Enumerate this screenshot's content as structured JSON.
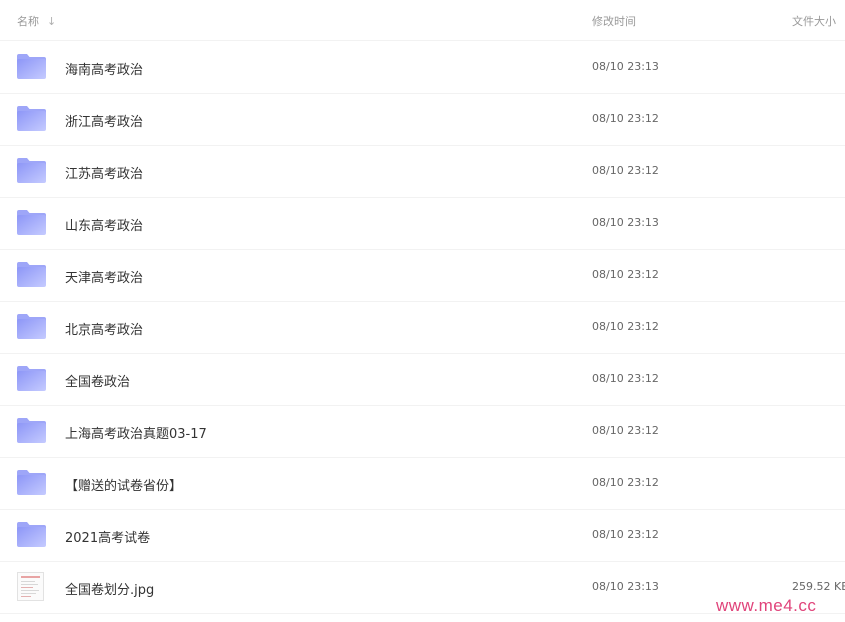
{
  "header": {
    "name_label": "名称",
    "sort_icon": "↓",
    "time_label": "修改时间",
    "size_label": "文件大小"
  },
  "colors": {
    "folder_light": "#c5cbff",
    "folder_dark": "#8d96f7",
    "watermark": "#e0437a"
  },
  "rows": [
    {
      "type": "folder",
      "name": "海南高考政治",
      "time": "08/10 23:13",
      "size": ""
    },
    {
      "type": "folder",
      "name": "浙江高考政治",
      "time": "08/10 23:12",
      "size": ""
    },
    {
      "type": "folder",
      "name": "江苏高考政治",
      "time": "08/10 23:12",
      "size": ""
    },
    {
      "type": "folder",
      "name": "山东高考政治",
      "time": "08/10 23:13",
      "size": ""
    },
    {
      "type": "folder",
      "name": "天津高考政治",
      "time": "08/10 23:12",
      "size": ""
    },
    {
      "type": "folder",
      "name": "北京高考政治",
      "time": "08/10 23:12",
      "size": ""
    },
    {
      "type": "folder",
      "name": "全国卷政治",
      "time": "08/10 23:12",
      "size": ""
    },
    {
      "type": "folder",
      "name": "上海高考政治真题03-17",
      "time": "08/10 23:12",
      "size": ""
    },
    {
      "type": "folder",
      "name": "【赠送的试卷省份】",
      "time": "08/10 23:12",
      "size": ""
    },
    {
      "type": "folder",
      "name": "2021高考试卷",
      "time": "08/10 23:12",
      "size": ""
    },
    {
      "type": "image",
      "name": "全国卷划分.jpg",
      "time": "08/10 23:13",
      "size": "259.52 KB"
    }
  ],
  "watermark": "www.me4.cc"
}
